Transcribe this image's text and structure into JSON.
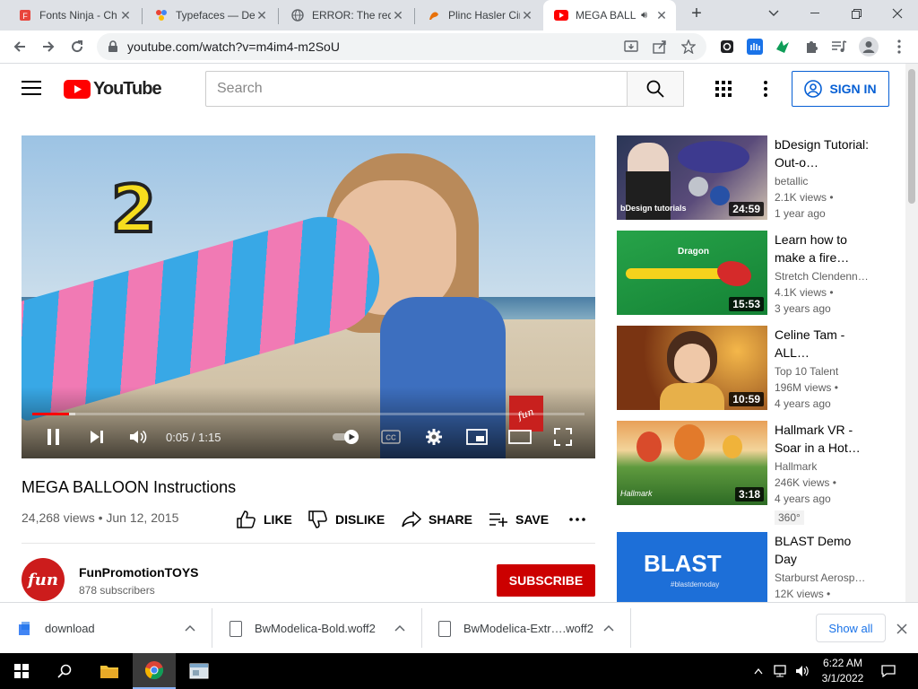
{
  "browser": {
    "tabs": [
      {
        "title": "Fonts Ninja - Ch",
        "icon": "fonts-ninja-icon"
      },
      {
        "title": "Typefaces — De",
        "icon": "typefaces-icon"
      },
      {
        "title": "ERROR: The requ",
        "icon": "globe-icon"
      },
      {
        "title": "Plinc Hasler Circ",
        "icon": "plinc-icon"
      },
      {
        "title": "MEGA BALL",
        "icon": "youtube-icon",
        "active": true
      }
    ],
    "url": "youtube.com/watch?v=m4im4-m2SoU"
  },
  "youtube": {
    "logo_text": "YouTube",
    "search_placeholder": "Search",
    "signin_label": "SIGN IN"
  },
  "video": {
    "overlay_number": "2",
    "time": "0:05 / 1:15",
    "progress": 0.0667,
    "title": "MEGA BALLOON Instructions",
    "views_date": "24,268 views • Jun 12, 2015",
    "actions": {
      "like": "LIKE",
      "dislike": "DISLIKE",
      "share": "SHARE",
      "save": "SAVE"
    },
    "channel": {
      "name": "FunPromotionTOYS",
      "subscribers": "878 subscribers",
      "avatar_text": "fun"
    },
    "subscribe_label": "SUBSCRIBE"
  },
  "recommendations": [
    {
      "title": "bDesign Tutorial: Out-o…",
      "channel": "betallic",
      "views": "2.1K views •",
      "age": "1 year ago",
      "duration": "24:59",
      "thumb_label": "bDesign tutorials"
    },
    {
      "title": "Learn how to make a fire…",
      "channel": "Stretch Clendenn…",
      "views": "4.1K views •",
      "age": "3 years ago",
      "duration": "15:53",
      "thumb_label": "Dragon"
    },
    {
      "title": "Celine Tam - ALL…",
      "channel": "Top 10 Talent",
      "views": "196M views •",
      "age": "4 years ago",
      "duration": "10:59"
    },
    {
      "title": "Hallmark VR - Soar in a Hot…",
      "channel": "Hallmark",
      "views": "246K views •",
      "age": "4 years ago",
      "duration": "3:18",
      "badge": "360°",
      "thumb_label": "Hallmark"
    },
    {
      "title": "BLAST Demo Day",
      "channel": "Starburst Aerosp…",
      "views": "12K views •",
      "age": "",
      "duration": "",
      "thumb_label": "BLAST",
      "thumb_sub": "#blastdemoday"
    }
  ],
  "downloads": [
    {
      "name": "download"
    },
    {
      "name": "BwModelica-Bold.woff2"
    },
    {
      "name": "BwModelica-Extr….woff2"
    }
  ],
  "show_all_label": "Show all",
  "taskbar": {
    "time": "6:22 AM",
    "date": "3/1/2022"
  },
  "colors": {
    "youtube_red": "#ff0000",
    "subscribe_red": "#cc0000",
    "signin_blue": "#065fd4"
  }
}
